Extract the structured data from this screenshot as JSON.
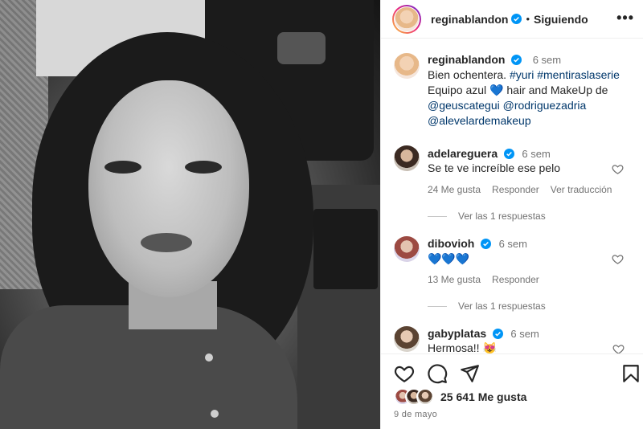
{
  "post": {
    "username": "reginablandon",
    "follow_status": "Siguiendo",
    "more": "•••",
    "caption_time": "6 sem",
    "caption_line1_prefix": "Bien ochentera. ",
    "hashtag1": "#yuri",
    "hashtag2": "#mentiraslaserie",
    "caption_line2_a": "Equipo azul ",
    "blue_heart": "💙",
    "caption_line2_b": " hair and MakeUp de",
    "mention1": "@geuscategui",
    "mention2": "@rodriguezadria",
    "mention3": "@alevelardemakeup"
  },
  "comments": [
    {
      "username": "adelareguera",
      "time": "6 sem",
      "text": "Se te ve increíble ese pelo",
      "likes": "24 Me gusta",
      "reply": "Responder",
      "translate": "Ver traducción",
      "replies": "Ver las 1 respuestas"
    },
    {
      "username": "dibovioh",
      "time": "6 sem",
      "text": "💙💙💙",
      "likes": "13 Me gusta",
      "reply": "Responder",
      "replies": "Ver las 1 respuestas"
    },
    {
      "username": "gabyplatas",
      "time": "6 sem",
      "text": "Hermosa!! 😻"
    }
  ],
  "footer": {
    "likes": "25 641 Me gusta",
    "date": "9 de mayo"
  },
  "colors": {
    "verified": "#0095f6",
    "link": "#00376b",
    "muted": "#737373"
  }
}
